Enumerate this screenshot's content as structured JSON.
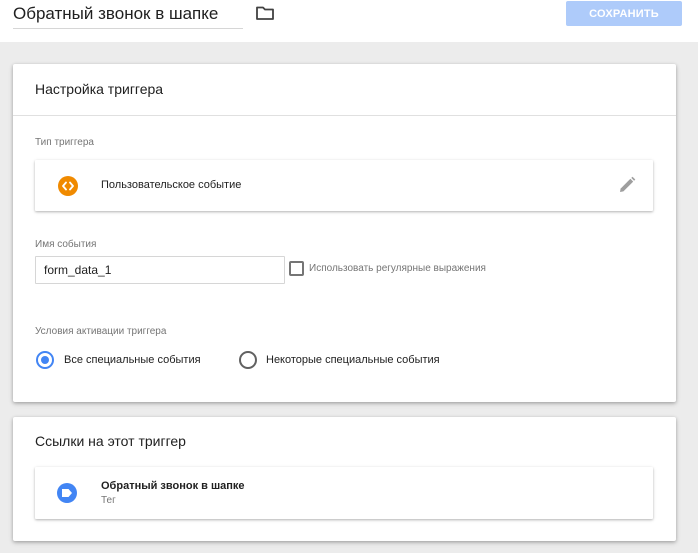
{
  "header": {
    "title": "Обратный звонок в шапке",
    "save_label": "СОХРАНИТЬ",
    "folder_icon": "folder-icon"
  },
  "config": {
    "heading": "Настройка триггера",
    "trigger_type": {
      "label": "Тип триггера",
      "name": "Пользовательское событие",
      "icon": "custom-event-icon",
      "icon_color": "#f08a00",
      "edit_icon": "pencil-icon"
    },
    "event_name": {
      "label": "Имя события",
      "value": "form_data_1"
    },
    "regex": {
      "label": "Использовать регулярные выражения",
      "checked": false
    },
    "activation": {
      "label": "Условия активации триггера",
      "options": [
        {
          "label": "Все специальные события",
          "selected": true
        },
        {
          "label": "Некоторые специальные события",
          "selected": false
        }
      ]
    }
  },
  "references": {
    "heading": "Ссылки на этот триггер",
    "items": [
      {
        "title": "Обратный звонок в шапке",
        "subtitle": "Тег",
        "icon": "tag-icon",
        "icon_color": "#4285f4"
      }
    ]
  },
  "colors": {
    "accent": "#4285f4",
    "save_button_disabled": "#aecbfa",
    "background": "#ececec"
  }
}
